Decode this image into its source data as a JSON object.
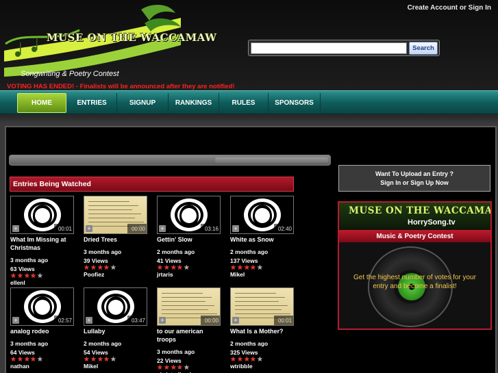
{
  "header": {
    "account_link": "Create Account or Sign In",
    "logo_title": "MUSE ON THE WACCAMAW",
    "logo_subtitle": "Songwriting & Poetry Contest",
    "voting_notice": "VOTING HAS ENDED! - Finalists will be announced after they are notified!",
    "search": {
      "value": "",
      "button_label": "Search"
    }
  },
  "nav": {
    "items": [
      {
        "label": "HOME",
        "active": true
      },
      {
        "label": "ENTRIES"
      },
      {
        "label": "SIGNUP"
      },
      {
        "label": "RANKINGS"
      },
      {
        "label": "RULES"
      },
      {
        "label": "SPONSORS"
      }
    ]
  },
  "main": {
    "section_title": "Entries Being Watched",
    "entries": [
      {
        "title": "What Im Missing at Christmas",
        "date": "3 months ago",
        "views": "63 Views",
        "user": "ellenl",
        "duration": "00:01",
        "thumb": "avatar",
        "rating": 4
      },
      {
        "title": "Dried Trees",
        "date": "3 months ago",
        "views": "39 Views",
        "user": "Poofiez",
        "duration": "00:00",
        "thumb": "lyrics",
        "rating": 4
      },
      {
        "title": "Gettin' Slow",
        "date": "2 months ago",
        "views": "41 Views",
        "user": "jrtaris",
        "duration": "03:16",
        "thumb": "avatar",
        "rating": 4
      },
      {
        "title": "White as Snow",
        "date": "2 months ago",
        "views": "137 Views",
        "user": "Mikel",
        "duration": "02:40",
        "thumb": "avatar",
        "rating": 4
      },
      {
        "title": "analog rodeo",
        "date": "3 months ago",
        "views": "64 Views",
        "user": "nathan",
        "duration": "02:57",
        "thumb": "avatar",
        "rating": 4
      },
      {
        "title": "Lullaby",
        "date": "2 months ago",
        "views": "54 Views",
        "user": "Mikel",
        "duration": "03:47",
        "thumb": "avatar",
        "rating": 4
      },
      {
        "title": "to our american troops",
        "date": "3 months ago",
        "views": "22 Views",
        "user": "christydbeck",
        "duration": "00:00",
        "thumb": "lyrics",
        "rating": 4
      },
      {
        "title": "What Is a Mother?",
        "date": "2 months ago",
        "views": "325 Views",
        "user": "wtribble",
        "duration": "00:01",
        "thumb": "lyrics",
        "rating": 4
      }
    ]
  },
  "sidebar": {
    "upload_line1": "Want To Upload an Entry ?",
    "upload_line2": "Sign In or Sign Up Now",
    "promo": {
      "title": "MUSE ON THE WACCAMAW",
      "site": "HorrySong.tv",
      "band": "Music & Poetry Contest",
      "text": "Get the highest number of votes for your entry and become a finalist!"
    }
  },
  "colors": {
    "accent_red": "#b0182a",
    "nav_teal": "#0f5e5c",
    "logo_green": "#a9d43a",
    "star_fill": "#e0392f"
  }
}
